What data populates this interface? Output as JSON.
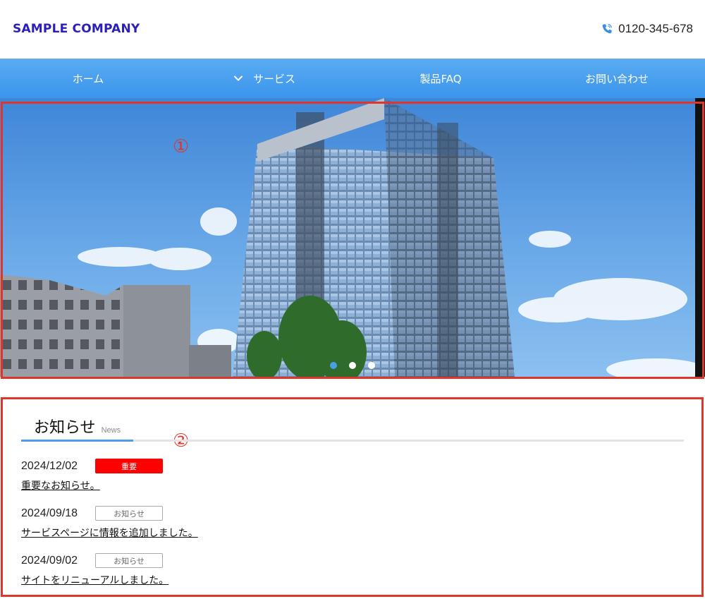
{
  "header": {
    "logo": "SAMPLE COMPANY",
    "phone_icon": "phone-icon",
    "phone": "0120-345-678"
  },
  "nav": {
    "items": [
      {
        "label": "ホーム"
      },
      {
        "label": "サービス",
        "icon": "chevron-down-icon"
      },
      {
        "label": "製品FAQ"
      },
      {
        "label": "お問い合わせ"
      }
    ]
  },
  "hero": {
    "marker": "①",
    "slides_total": 3,
    "active_slide": 1
  },
  "news": {
    "marker": "②",
    "title": "お知らせ",
    "subtitle": "News",
    "items": [
      {
        "date": "2024/12/02",
        "badge": "重要",
        "badge_type": "important",
        "text": "重要なお知らせ。"
      },
      {
        "date": "2024/09/18",
        "badge": "お知らせ",
        "badge_type": "notice",
        "text": "サービスページに情報を追加しました。"
      },
      {
        "date": "2024/09/02",
        "badge": "お知らせ",
        "badge_type": "notice",
        "text": "サイトをリニューアルしました。"
      }
    ]
  },
  "colors": {
    "logo": "#2a1fb8",
    "nav": "#3b95ec",
    "annotation": "#e0352b",
    "accent": "#4a9fe8",
    "important": "#ff0000"
  }
}
